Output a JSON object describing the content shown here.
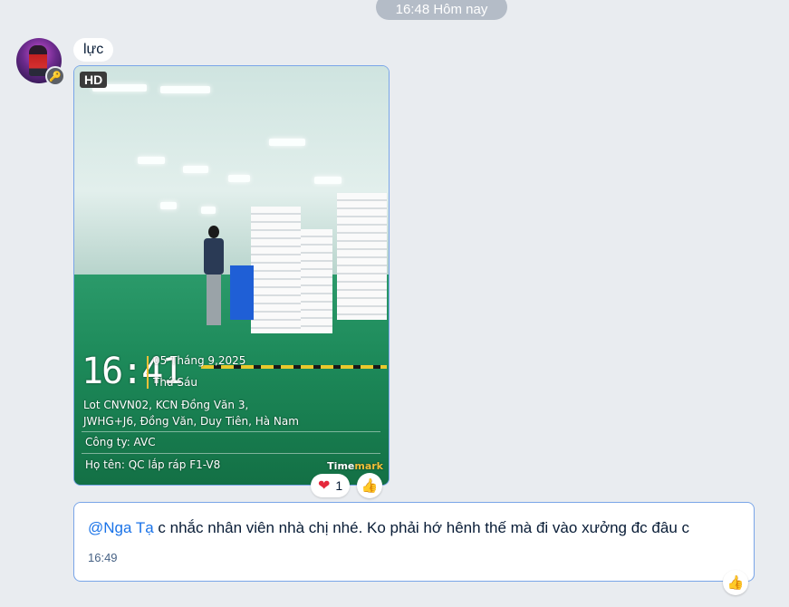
{
  "date_separator": "16:48 Hôm nay",
  "sender": {
    "avatar_icon": "user-avatar-icon",
    "badge_icon": "key-icon",
    "badge_glyph": "🔑"
  },
  "messages": [
    {
      "type": "text",
      "text": "lực"
    },
    {
      "type": "image",
      "quality_tag": "HD",
      "timestamp_overlay": {
        "time": "16:41",
        "date": "05 Tháng 9,2025",
        "weekday": "Thứ Sáu",
        "address_line1": "Lot CNVN02, KCN Đồng Văn 3,",
        "address_line2": "JWHG+J6, Đồng Văn, Duy Tiên, Hà Nam",
        "company": "Công ty: AVC",
        "fullname": "Họ tên: QC lắp ráp F1-V8",
        "brand_prefix": "Time",
        "brand_suffix": "mark"
      },
      "reactions": {
        "heart_glyph": "❤",
        "count": "1"
      }
    },
    {
      "type": "text",
      "mention": "@Nga Tạ",
      "text": " c nhắc nhân viên nhà chị nhé. Ko phải hớ hênh thế mà đi vào xưởng đc đâu c",
      "time": "16:49"
    }
  ],
  "like_glyph": "👍",
  "colors": {
    "mention": "#1a73e8",
    "background": "#e9ecf0",
    "bubble_border": "#79a5e8"
  }
}
